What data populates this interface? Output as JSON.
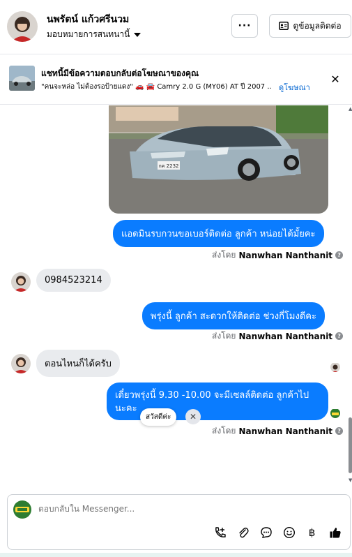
{
  "header": {
    "contact_name": "นพรัตน์ แก้วศรีนวม",
    "assignee": "มอบหมายการสนทนานี้",
    "more_label": "···",
    "contact_info_label": "ดูข้อมูลติดต่อ",
    "icons": [
      "chevron-down-icon",
      "contact-card-icon"
    ]
  },
  "ad": {
    "title": "แชทนี้มีข้อความตอบกลับต่อโฆษณาของคุณ",
    "subtitle": "\"คนจะหล่อ ไม่ต้องรอป้ายแดง\" 🚗 🚘 Camry 2.0 G (MY06) AT ปี 2007 ...",
    "link": "ดูโฆษณา",
    "close_label": "✕"
  },
  "thread": {
    "messages": [
      {
        "side": "out",
        "text": "แอดมินรบกวนขอเบอร์ติดต่อ ลูกค้า หน่อยได้มั้ยคะ"
      },
      {
        "side": "in",
        "text": "0984523214"
      },
      {
        "side": "out",
        "text": "พรุ่งนี้ ลูกค้า สะดวกให้ติดต่อ ช่วงกี่โมงดีคะ"
      },
      {
        "side": "in",
        "text": "ตอนไหนก็ได้ครับ"
      },
      {
        "side": "out",
        "text": "เดี๋ยวพรุ่งนี้ 9.30 -10.00 จะมีเซลล์ติดต่อ ลูกค้าไป นะคะ"
      }
    ],
    "sent_by_prefix": "ส่งโดย",
    "sent_by_name": "Nanwhan Nanthanit",
    "photo_plate": "กค 2232",
    "quick_reply_chip": "สวัสดีค่ะ",
    "chip_close": "✕"
  },
  "composer": {
    "placeholder": "ตอบกลับใน Messenger...",
    "tools": [
      "phone-plus-icon",
      "paperclip-icon",
      "chat-bubble-icon",
      "emoji-icon",
      "baht-icon",
      "thumbs-up-icon"
    ],
    "baht_symbol": "฿"
  },
  "colors": {
    "outgoing_bubble": "#0a7cff",
    "incoming_bubble": "#e9ebee",
    "link": "#0064d1"
  }
}
